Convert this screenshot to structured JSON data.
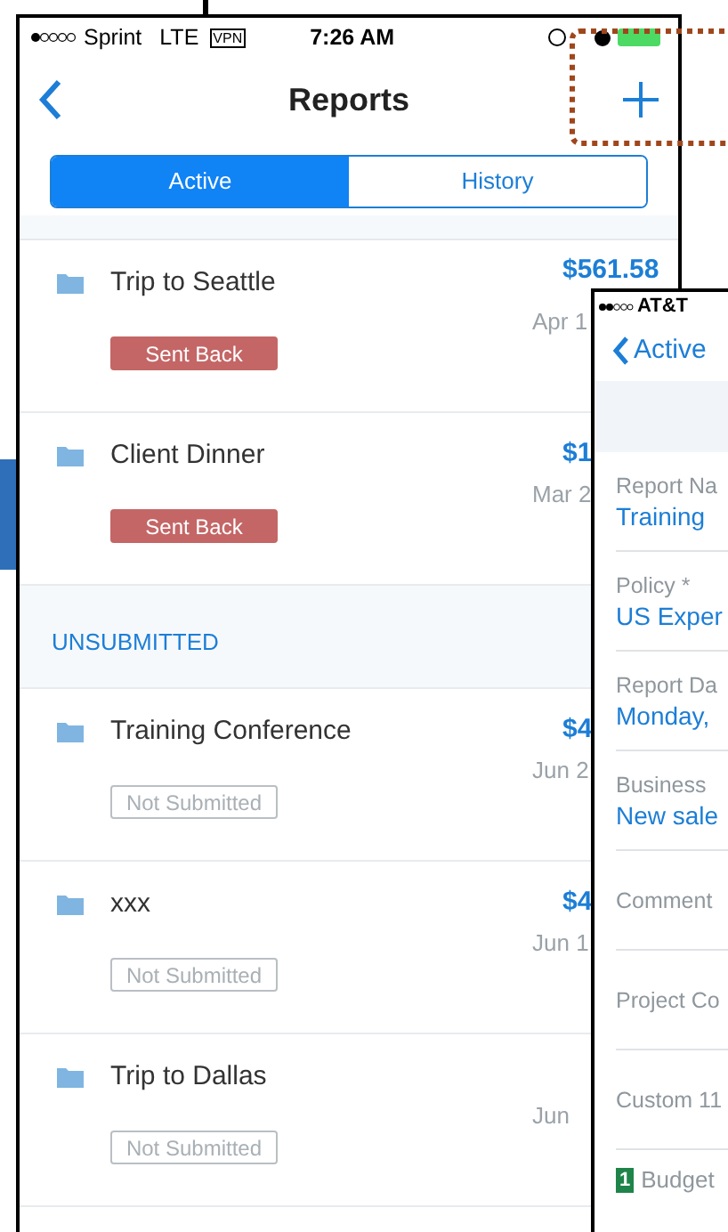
{
  "main_phone": {
    "status_bar": {
      "carrier": "Sprint",
      "network": "LTE",
      "vpn": "VPN",
      "time": "7:26 AM"
    },
    "nav": {
      "title": "Reports"
    },
    "tabs": [
      {
        "label": "Active",
        "selected": true
      },
      {
        "label": "History",
        "selected": false
      }
    ],
    "sections": [
      {
        "reports": [
          {
            "name": "Trip to Seattle",
            "amount": "$561.58",
            "date": "Apr 1",
            "status": {
              "kind": "sent_back",
              "label": "Sent Back"
            }
          },
          {
            "name": "Client Dinner",
            "amount": "$1",
            "date": "Mar 2",
            "status": {
              "kind": "sent_back",
              "label": "Sent Back"
            }
          }
        ]
      },
      {
        "header": "UNSUBMITTED",
        "reports": [
          {
            "name": "Training Conference",
            "amount": "$4",
            "date": "Jun 2",
            "status": {
              "kind": "not_submitted",
              "label": "Not Submitted"
            }
          },
          {
            "name": "xxx",
            "amount": "$4",
            "date": "Jun 1",
            "status": {
              "kind": "not_submitted",
              "label": "Not Submitted"
            }
          },
          {
            "name": "Trip to Dallas",
            "date": "Jun",
            "status": {
              "kind": "not_submitted",
              "label": "Not Submitted"
            }
          }
        ]
      }
    ]
  },
  "detail_phone": {
    "status_bar": {
      "carrier": "AT&T"
    },
    "back": "Active",
    "fields": [
      {
        "label": "Report Na",
        "value": "Training"
      },
      {
        "label": "Policy *",
        "value": "US Exper"
      },
      {
        "label": "Report Da",
        "value": "Monday,"
      },
      {
        "label": "Business",
        "value": "New sale"
      },
      {
        "label": "Comment"
      },
      {
        "label": "Project Co"
      },
      {
        "label": "Custom 11"
      }
    ],
    "footer": {
      "count": "1",
      "label": "Budget"
    }
  }
}
